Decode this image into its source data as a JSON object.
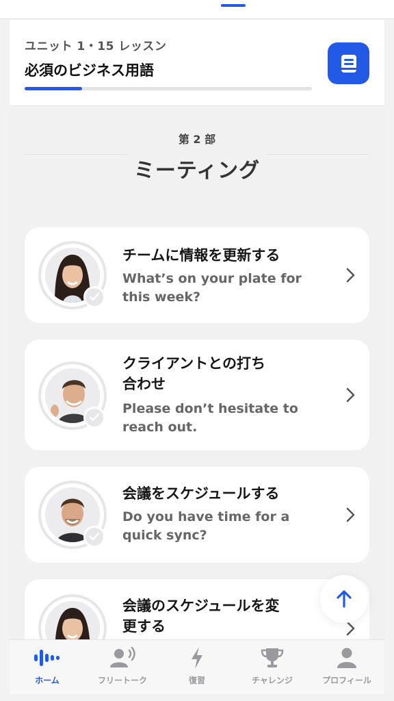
{
  "header": {
    "unit_label": "ユニット 1・15 レッスン",
    "title": "必須のビジネス用語",
    "progress_percent": 20,
    "book_icon": "book-icon"
  },
  "section": {
    "label": "第 2 部",
    "title": "ミーティング"
  },
  "lessons": [
    {
      "title_line1": "チームに情報を更新する",
      "title_line2": "",
      "subtitle_line1": "What’s on your plate for",
      "subtitle_line2": "this week?",
      "completed": true
    },
    {
      "title_line1": "クライアントとの打ち",
      "title_line2": "合わせ",
      "subtitle_line1": "Please don’t hesitate to",
      "subtitle_line2": "reach out.",
      "completed": true
    },
    {
      "title_line1": "会議をスケジュールする",
      "title_line2": "",
      "subtitle_line1": "Do you have time for a",
      "subtitle_line2": "quick sync?",
      "completed": true
    },
    {
      "title_line1": "会議のスケジュールを変",
      "title_line2": "更する",
      "subtitle_line1": "",
      "subtitle_line2": "",
      "completed": true
    }
  ],
  "tabs": [
    {
      "label": "ホーム",
      "icon": "audio-wave-icon",
      "active": true
    },
    {
      "label": "フリートーク",
      "icon": "speaking-person-icon",
      "active": false
    },
    {
      "label": "復習",
      "icon": "lightning-icon",
      "active": false
    },
    {
      "label": "チャレンジ",
      "icon": "trophy-icon",
      "active": false
    },
    {
      "label": "プロフィール",
      "icon": "person-icon",
      "active": false
    }
  ],
  "colors": {
    "accent": "#2259e6",
    "muted": "#9a9a9e",
    "card": "#ffffff",
    "background": "#f1f1f2"
  }
}
